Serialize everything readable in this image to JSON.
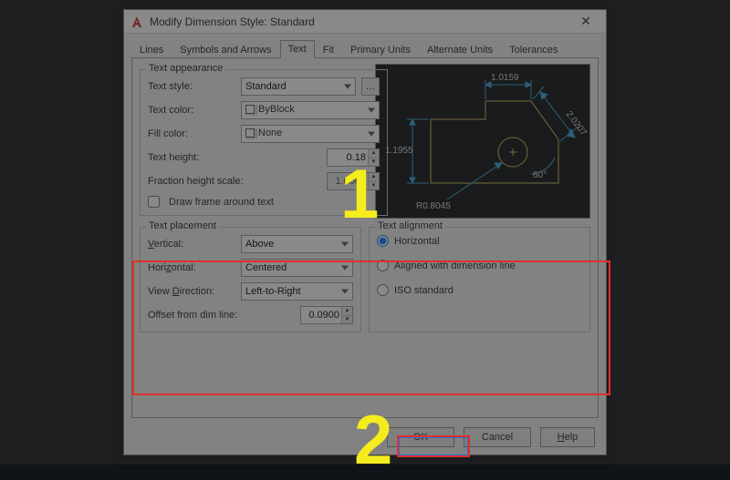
{
  "window": {
    "title": "Modify Dimension Style: Standard",
    "logo_color": "#d32027"
  },
  "tabs": [
    {
      "label": "Lines"
    },
    {
      "label": "Symbols and Arrows"
    },
    {
      "label": "Text"
    },
    {
      "label": "Fit"
    },
    {
      "label": "Primary Units"
    },
    {
      "label": "Alternate Units"
    },
    {
      "label": "Tolerances"
    }
  ],
  "active_tab": 2,
  "appearance": {
    "legend": "Text appearance",
    "text_style_label": "Text style:",
    "text_style_value": "Standard",
    "text_color_label": "Text color:",
    "text_color_value": "ByBlock",
    "fill_color_label": "Fill color:",
    "fill_color_value": "None",
    "text_height_label": "Text height:",
    "text_height_value": "0.18",
    "fraction_label": "Fraction height scale:",
    "fraction_value": "1.0000",
    "draw_frame_label": "Draw frame around text"
  },
  "placement": {
    "legend": "Text placement",
    "vertical_label": "Vertical:",
    "vertical_value": "Above",
    "horizontal_label": "Horizontal:",
    "horizontal_value": "Centered",
    "view_dir_label": "View Direction:",
    "view_dir_value": "Left-to-Right",
    "offset_label": "Offset from dim line:",
    "offset_value": "0.0900"
  },
  "alignment": {
    "legend": "Text alignment",
    "opt_horizontal": "Horizontal",
    "opt_aligned": "Aligned with dimension line",
    "opt_iso": "ISO standard",
    "selected": "horizontal"
  },
  "preview": {
    "d_top": "1.0159",
    "d_left": "1.1955",
    "d_right": "2.0207",
    "angle": "60°",
    "radius": "R0.8045"
  },
  "buttons": {
    "ok": "OK",
    "cancel": "Cancel",
    "help": "Help"
  },
  "annotations": {
    "n1": "1",
    "n2": "2"
  }
}
